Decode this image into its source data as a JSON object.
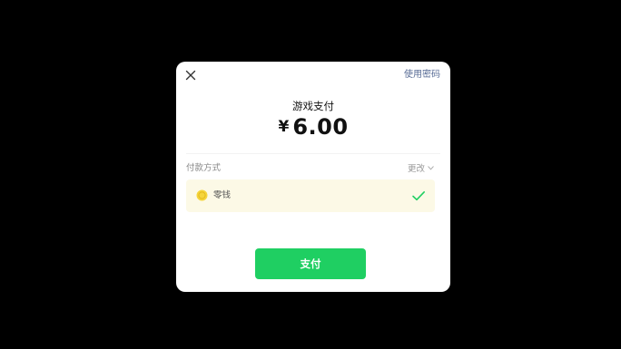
{
  "dialog": {
    "close_icon": "close-icon",
    "use_password_label": "使用密码",
    "title": "游戏支付",
    "currency_symbol": "¥",
    "amount": "6.00",
    "method_label": "付款方式",
    "change_label": "更改",
    "change_icon": "chevron-down-icon",
    "method": {
      "icon": "coin-icon",
      "name": "零钱",
      "selected": true,
      "check_icon": "check-icon"
    },
    "pay_button_label": "支付"
  },
  "colors": {
    "backdrop": "#000000",
    "link": "#576b95",
    "accent_green": "#1fcf62",
    "method_row_bg": "#fcf9e6",
    "coin": "#f5d53b"
  }
}
